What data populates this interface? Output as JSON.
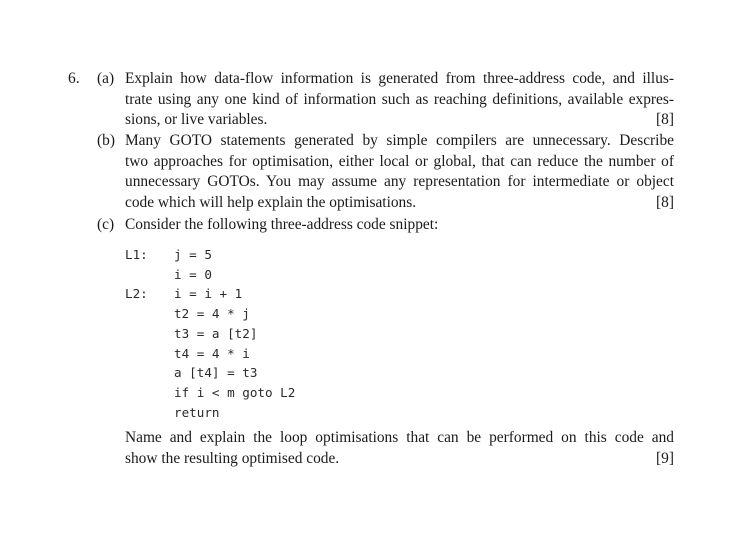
{
  "question": {
    "number": "6.",
    "parts": [
      {
        "label": "(a)",
        "lines": [
          "Explain how data-flow information is generated from three-address code, and illus-",
          "trate using any one kind of information such as reaching definitions, available expres-",
          "sions, or live variables."
        ],
        "marks": "[8]"
      },
      {
        "label": "(b)",
        "lines": [
          "Many GOTO statements generated by simple compilers are unnecessary.  Describe",
          "two approaches for optimisation, either local or global, that can reduce the number of",
          "unnecessary GOTOs. You may assume any representation for intermediate or object",
          "code which will help explain the optimisations."
        ],
        "marks": "[8]"
      },
      {
        "label": "(c)",
        "intro": "Consider the following three-address code snippet:",
        "code": [
          {
            "label": "L1:",
            "stmt": "j = 5"
          },
          {
            "label": "",
            "stmt": "i = 0"
          },
          {
            "label": "L2:",
            "stmt": "i = i + 1"
          },
          {
            "label": "",
            "stmt": "t2 = 4 * j"
          },
          {
            "label": "",
            "stmt": "t3 = a [t2]"
          },
          {
            "label": "",
            "stmt": "t4 = 4 * i"
          },
          {
            "label": "",
            "stmt": "a [t4] = t3"
          },
          {
            "label": "",
            "stmt": "if i < m goto L2"
          },
          {
            "label": "",
            "stmt": "return"
          }
        ],
        "lines": [
          "Name and explain the loop optimisations that can be performed on this code and",
          "show the resulting optimised code."
        ],
        "marks": "[9]"
      }
    ]
  }
}
